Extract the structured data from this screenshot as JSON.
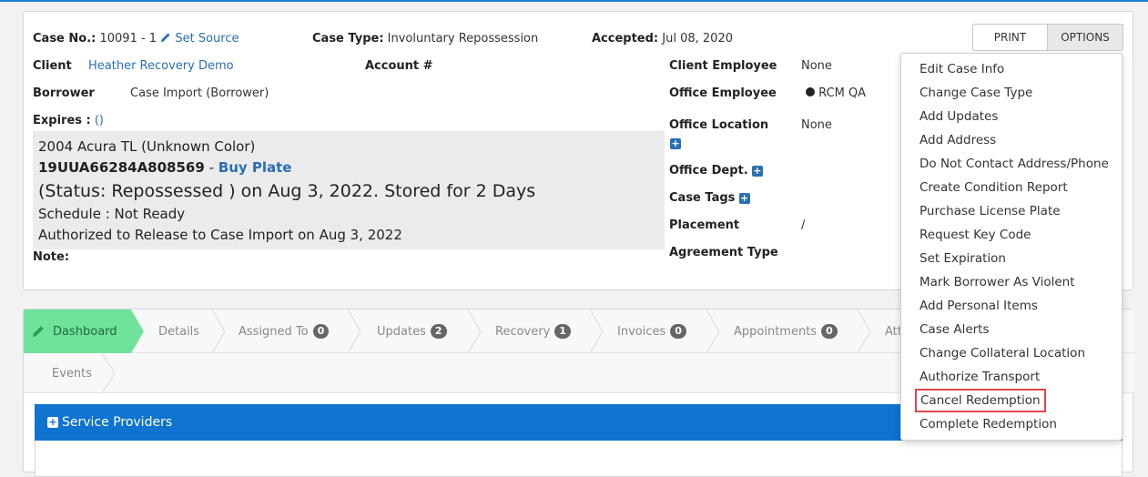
{
  "case": {
    "case_no_label": "Case No.:",
    "case_no_value": "10091 - 1",
    "set_source": "Set Source",
    "case_type_label": "Case Type:",
    "case_type_value": "Involuntary Repossession",
    "accepted_label": "Accepted:",
    "accepted_value": "Jul 08, 2020",
    "client_label": "Client",
    "client_value": "Heather Recovery Demo",
    "account_label": "Account #",
    "borrower_label": "Borrower",
    "borrower_value": "Case Import (Borrower)",
    "expires_label": "Expires :",
    "expires_value": "()",
    "note_label": "Note:",
    "client_employee_label": "Client Employee",
    "client_employee_value": "None",
    "office_employee_label": "Office Employee",
    "office_employee_value": "RCM QA",
    "office_location_label": "Office Location",
    "office_location_value": "None",
    "office_dept_label": "Office Dept.",
    "case_tags_label": "Case Tags",
    "placement_label": "Placement",
    "placement_value": "/",
    "agreement_type_label": "Agreement Type"
  },
  "vehicle": {
    "description": "2004 Acura TL (Unknown Color)",
    "vin": "19UUA66284A808569",
    "separator": " - ",
    "buy_plate": "Buy Plate",
    "status": "(Status: Repossessed ) on Aug 3, 2022. Stored for 2 Days",
    "schedule": "Schedule : Not Ready",
    "authorized": "Authorized to Release to Case Import on Aug 3, 2022"
  },
  "buttons": {
    "print": "PRINT",
    "options": "OPTIONS"
  },
  "tabs": [
    {
      "label": "Dashboard"
    },
    {
      "label": "Details"
    },
    {
      "label": "Assigned To",
      "badge": "0"
    },
    {
      "label": "Updates",
      "badge": "2"
    },
    {
      "label": "Recovery",
      "badge": "1"
    },
    {
      "label": "Invoices",
      "badge": "0"
    },
    {
      "label": "Appointments",
      "badge": "0"
    },
    {
      "label": "Att"
    }
  ],
  "tabs_row2": [
    {
      "label": "Events"
    }
  ],
  "service_providers": "Service Providers",
  "options_menu": [
    "Edit Case Info",
    "Change Case Type",
    "Add Updates",
    "Add Address",
    "Do Not Contact Address/Phone",
    "Create Condition Report",
    "Purchase License Plate",
    "Request Key Code",
    "Set Expiration",
    "Mark Borrower As Violent",
    "Add Personal Items",
    "Case Alerts",
    "Change Collateral Location",
    "Authorize Transport",
    "Cancel Redemption",
    "Complete Redemption"
  ],
  "colors": {
    "link": "#2a6fb5",
    "active_tab": "#6fe29b",
    "service_bar": "#0f73d0",
    "highlight_outline": "#e0474c"
  }
}
